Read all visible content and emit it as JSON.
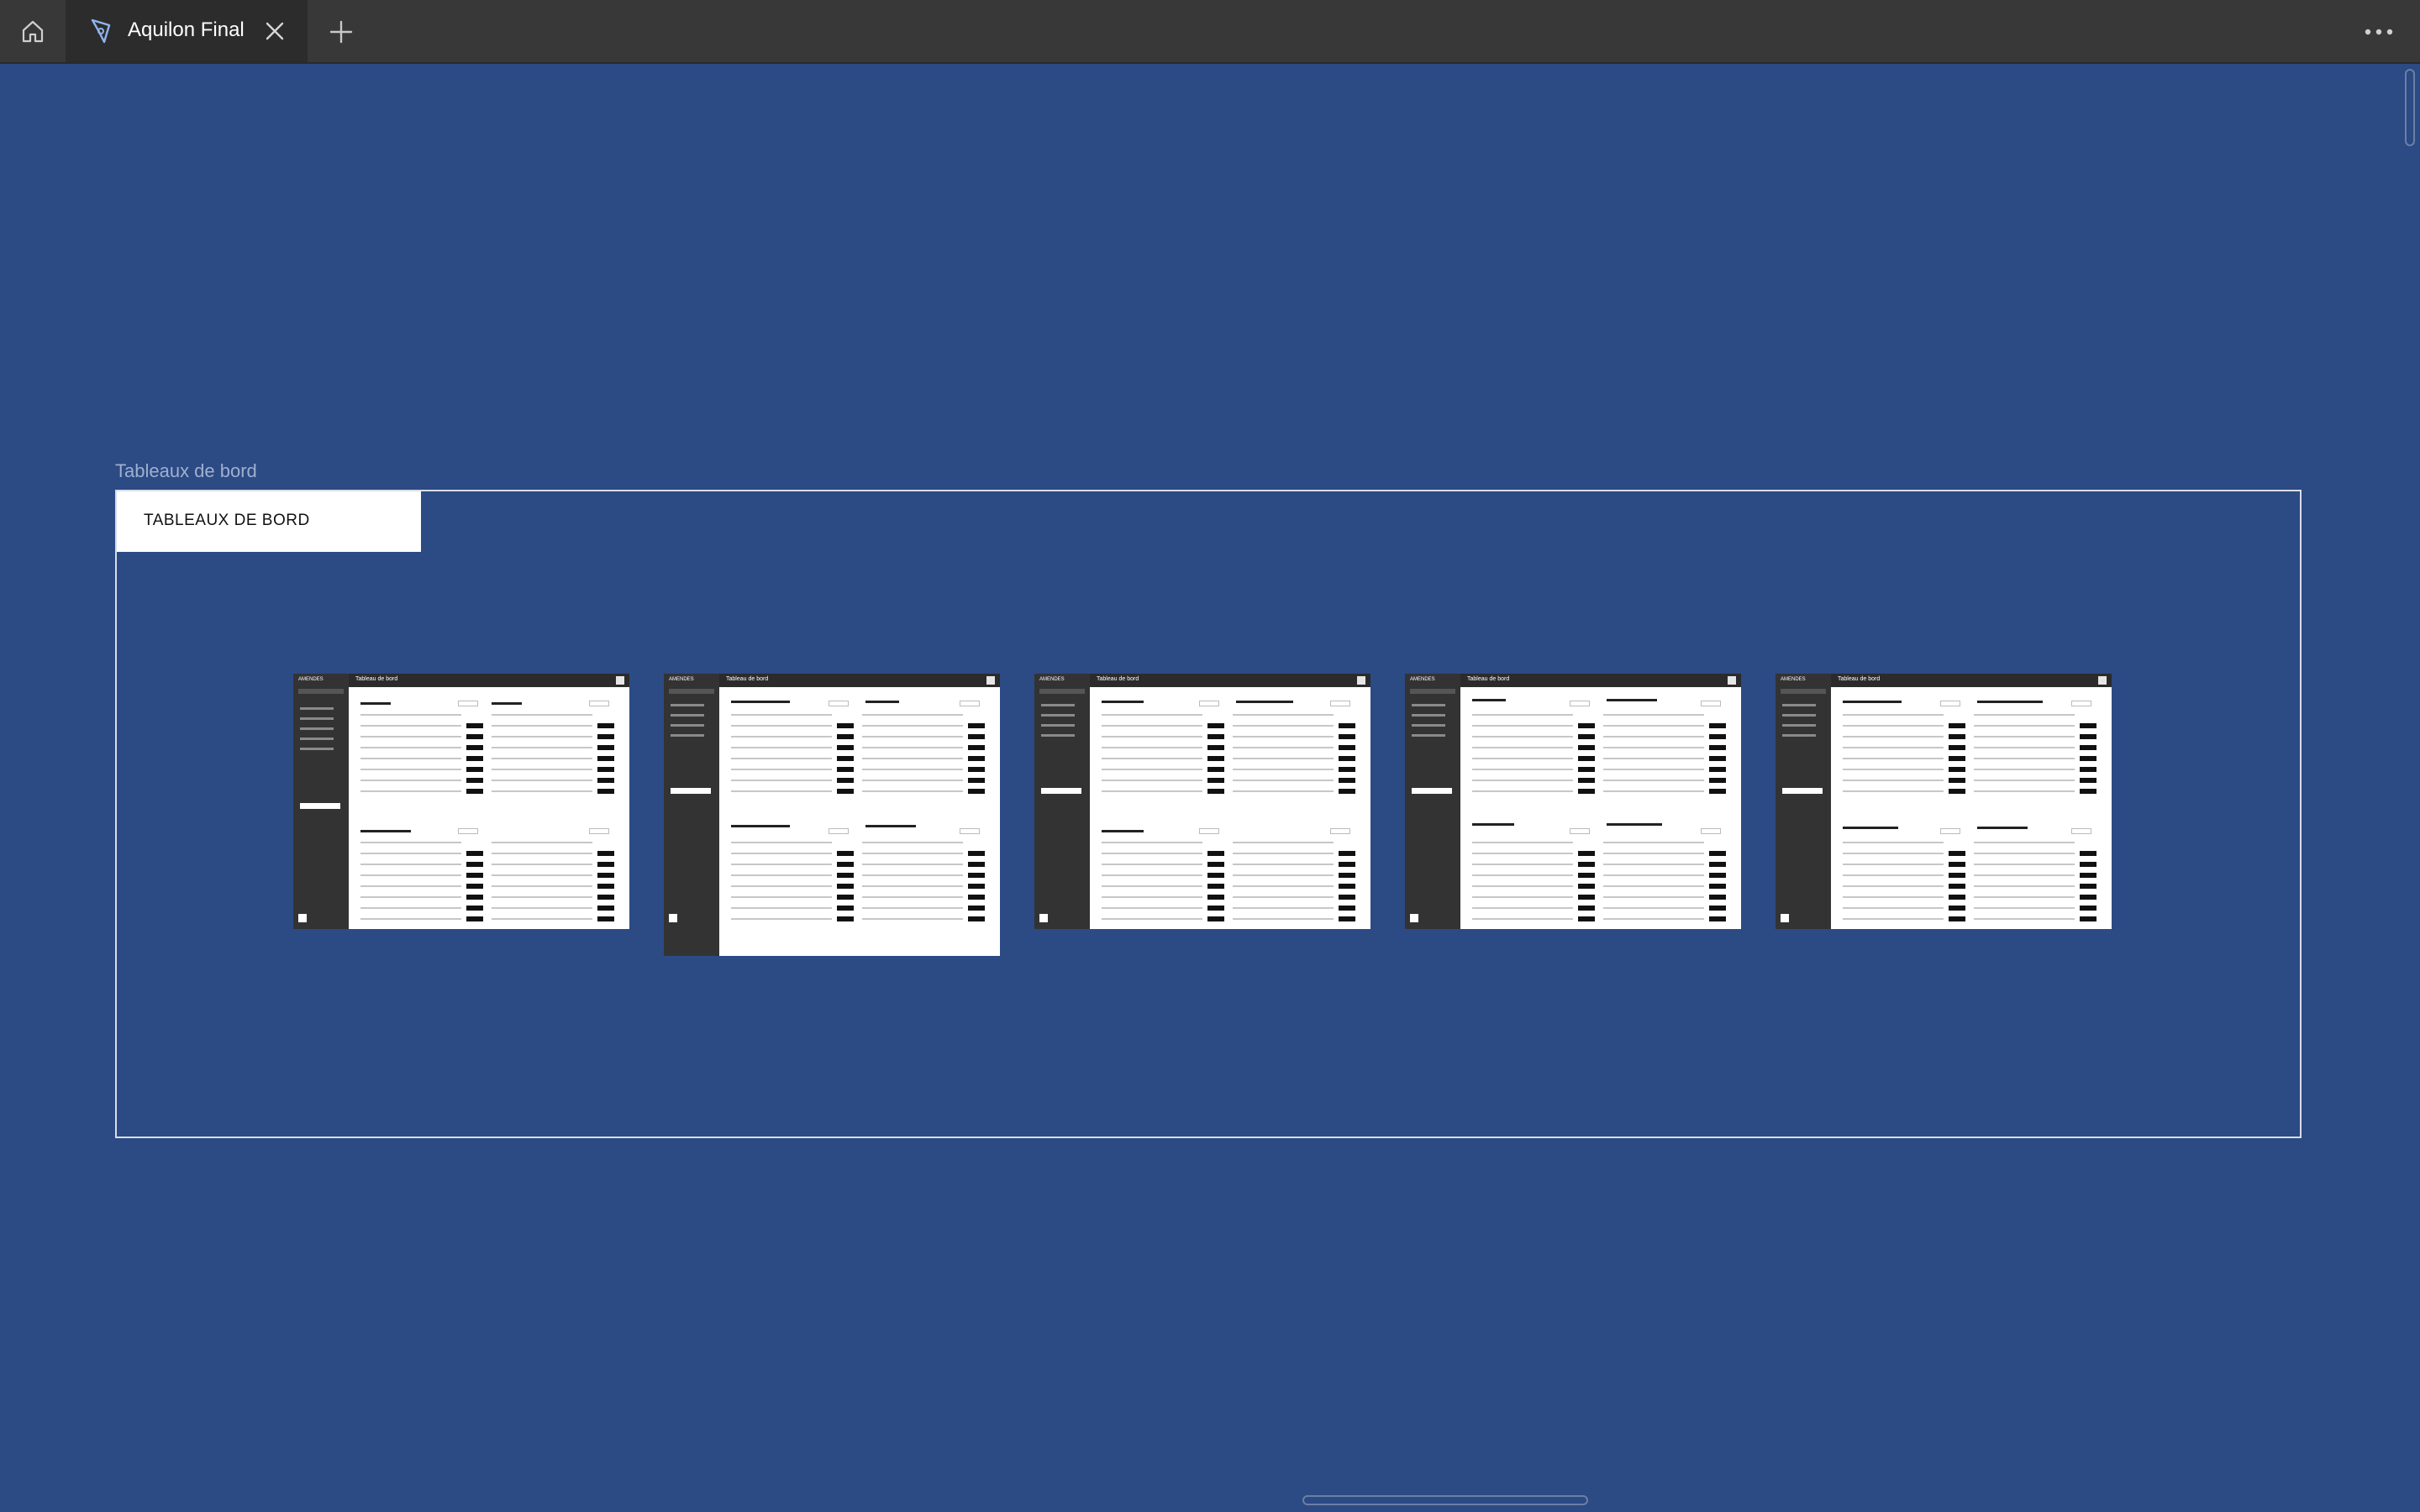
{
  "app": {
    "tab_title": "Aquilon Final",
    "icons": {
      "home": "home-icon",
      "tab": "compass-icon",
      "close": "close-icon",
      "add": "plus-icon",
      "more": "more-horizontal-icon"
    }
  },
  "canvas": {
    "background_color": "#2c4a84",
    "section": {
      "label": "Tableaux de bord",
      "header": "TABLEAUX DE BORD"
    },
    "thumbnails": [
      {
        "title": "Tableau de bord",
        "brand": "AMENDES"
      },
      {
        "title": "Tableau de bord",
        "brand": "AMENDES"
      },
      {
        "title": "Tableau de bord",
        "brand": "AMENDES"
      },
      {
        "title": "Tableau de bord",
        "brand": "AMENDES"
      },
      {
        "title": "Tableau de bord",
        "brand": "AMENDES"
      }
    ]
  }
}
